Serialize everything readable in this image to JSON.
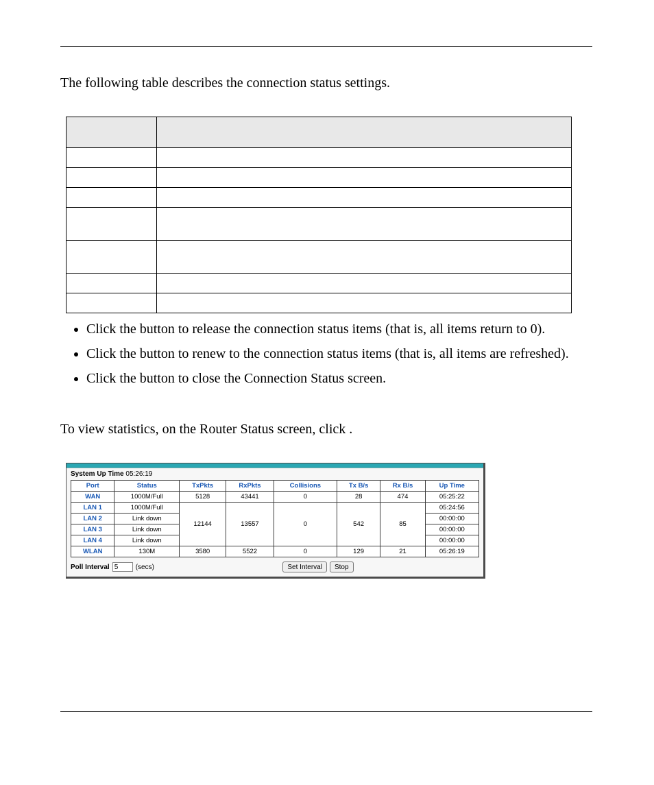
{
  "intro": "The following table describes the connection status settings.",
  "settings_table": {
    "headers": [
      "",
      ""
    ],
    "rows_count": 7
  },
  "bullets": [
    {
      "pre": "Click the ",
      "mid": "",
      "post": " button to release the connection status items (that is, all items return to 0)."
    },
    {
      "pre": "Click the ",
      "mid": "",
      "post": " button to renew to the connection status items (that is, all items are refreshed)."
    },
    {
      "pre": "Click the ",
      "mid": "",
      "post": " button to close the Connection Status screen."
    }
  ],
  "stats_intro": {
    "pre": "To view statistics, on the Router Status screen, click ",
    "post": " ."
  },
  "screenshot": {
    "uptime_label": "System Up Time",
    "uptime_value": "05:26:19",
    "headers": [
      "Port",
      "Status",
      "TxPkts",
      "RxPkts",
      "Collisions",
      "Tx B/s",
      "Rx B/s",
      "Up Time"
    ],
    "rows": [
      {
        "port": "WAN",
        "status": "1000M/Full",
        "tx": "5128",
        "rx": "43441",
        "col": "0",
        "txb": "28",
        "rxb": "474",
        "up": "05:25:22"
      },
      {
        "port": "LAN 1",
        "status": "1000M/Full",
        "tx": "",
        "rx": "",
        "col": "",
        "txb": "",
        "rxb": "",
        "up": "05:24:56"
      },
      {
        "port": "LAN 2",
        "status": "Link down",
        "tx": "12144",
        "rx": "13557",
        "col": "0",
        "txb": "542",
        "rxb": "85",
        "up": "00:00:00"
      },
      {
        "port": "LAN 3",
        "status": "Link down",
        "tx": "",
        "rx": "",
        "col": "",
        "txb": "",
        "rxb": "",
        "up": "00:00:00"
      },
      {
        "port": "LAN 4",
        "status": "Link down",
        "tx": "",
        "rx": "",
        "col": "",
        "txb": "",
        "rxb": "",
        "up": "00:00:00"
      },
      {
        "port": "WLAN",
        "status": "130M",
        "tx": "3580",
        "rx": "5522",
        "col": "0",
        "txb": "129",
        "rxb": "21",
        "up": "05:26:19"
      }
    ],
    "poll_label": "Poll Interval",
    "poll_value": "5",
    "poll_unit": "(secs)",
    "btn_set": "Set Interval",
    "btn_stop": "Stop"
  }
}
